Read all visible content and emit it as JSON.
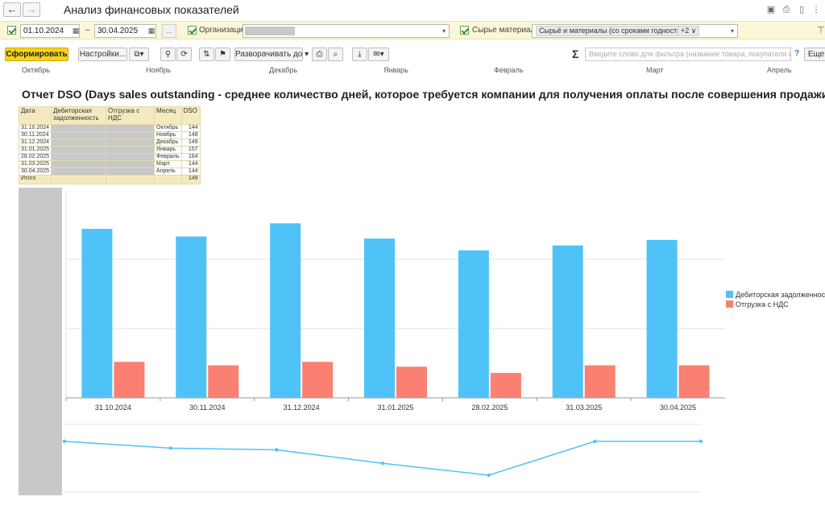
{
  "window": {
    "title": "Анализ финансовых показателей"
  },
  "filters": {
    "date_from": "01.10.2024",
    "date_sep": "–",
    "date_to": "30.04.2025",
    "org_label": "Организация:",
    "raw_label": "Сырье материалы:",
    "raw_tag": "Сырьё и материалы (со сроками годности) ×",
    "raw_more": "+2 ∨"
  },
  "toolbar": {
    "generate": "Сформировать",
    "settings": "Настройки...",
    "expand": "Разворачивать до",
    "sigma": "Σ",
    "search_placeholder": "Введите слово для фильтра (название товара, покупателя и пр.)",
    "help": "?",
    "more": "Еще"
  },
  "month_header": [
    "Октябрь",
    "Ноябрь",
    "Декабрь",
    "Январь",
    "Февраль",
    "Март",
    "Апрель"
  ],
  "report": {
    "title": "Отчет DSO (Days sales outstanding - среднее количество дней, которое требуется компании для получения оплаты после совершения продажи)",
    "columns": [
      "Дата",
      "Дебиторская задолженность",
      "Отгрузка с НДС",
      "Месяц",
      "DSO"
    ],
    "rows": [
      {
        "date": "31.10.2024",
        "month": "Октябрь",
        "dso": "144"
      },
      {
        "date": "30.11.2024",
        "month": "Ноябрь",
        "dso": "148"
      },
      {
        "date": "31.12.2024",
        "month": "Декабрь",
        "dso": "149"
      },
      {
        "date": "31.01.2025",
        "month": "Январь",
        "dso": "157"
      },
      {
        "date": "28.02.2025",
        "month": "Февраль",
        "dso": "164"
      },
      {
        "date": "31.03.2025",
        "month": "Март",
        "dso": "144"
      },
      {
        "date": "30.04.2025",
        "month": "Апрель",
        "dso": "144"
      }
    ],
    "total_label": "Итого",
    "total_dso": "149"
  },
  "colors": {
    "receivables": "#4fc3f7",
    "shipments": "#fa8072",
    "line": "#4fc3f7"
  },
  "chart_data": [
    {
      "type": "bar",
      "categories": [
        "31.10.2024",
        "30.11.2024",
        "31.12.2024",
        "31.01.2025",
        "28.02.2025",
        "31.03.2025",
        "30.04.2025"
      ],
      "series": [
        {
          "name": "Дебиторская задолженность",
          "values": [
            244,
            233,
            252,
            230,
            213,
            220,
            228
          ]
        },
        {
          "name": "Отгрузка с НДС",
          "values": [
            52,
            47,
            52,
            45,
            36,
            47,
            47
          ]
        }
      ],
      "ylim": [
        0,
        300
      ],
      "grid": true,
      "legend": "right"
    },
    {
      "type": "line",
      "categories": [
        "31.10.2024",
        "30.11.2024",
        "31.12.2024",
        "31.01.2025",
        "28.02.2025",
        "31.03.2025",
        "30.04.2025"
      ],
      "series": [
        {
          "values": [
            144,
            148,
            149,
            157,
            164,
            144,
            144
          ]
        }
      ]
    }
  ]
}
